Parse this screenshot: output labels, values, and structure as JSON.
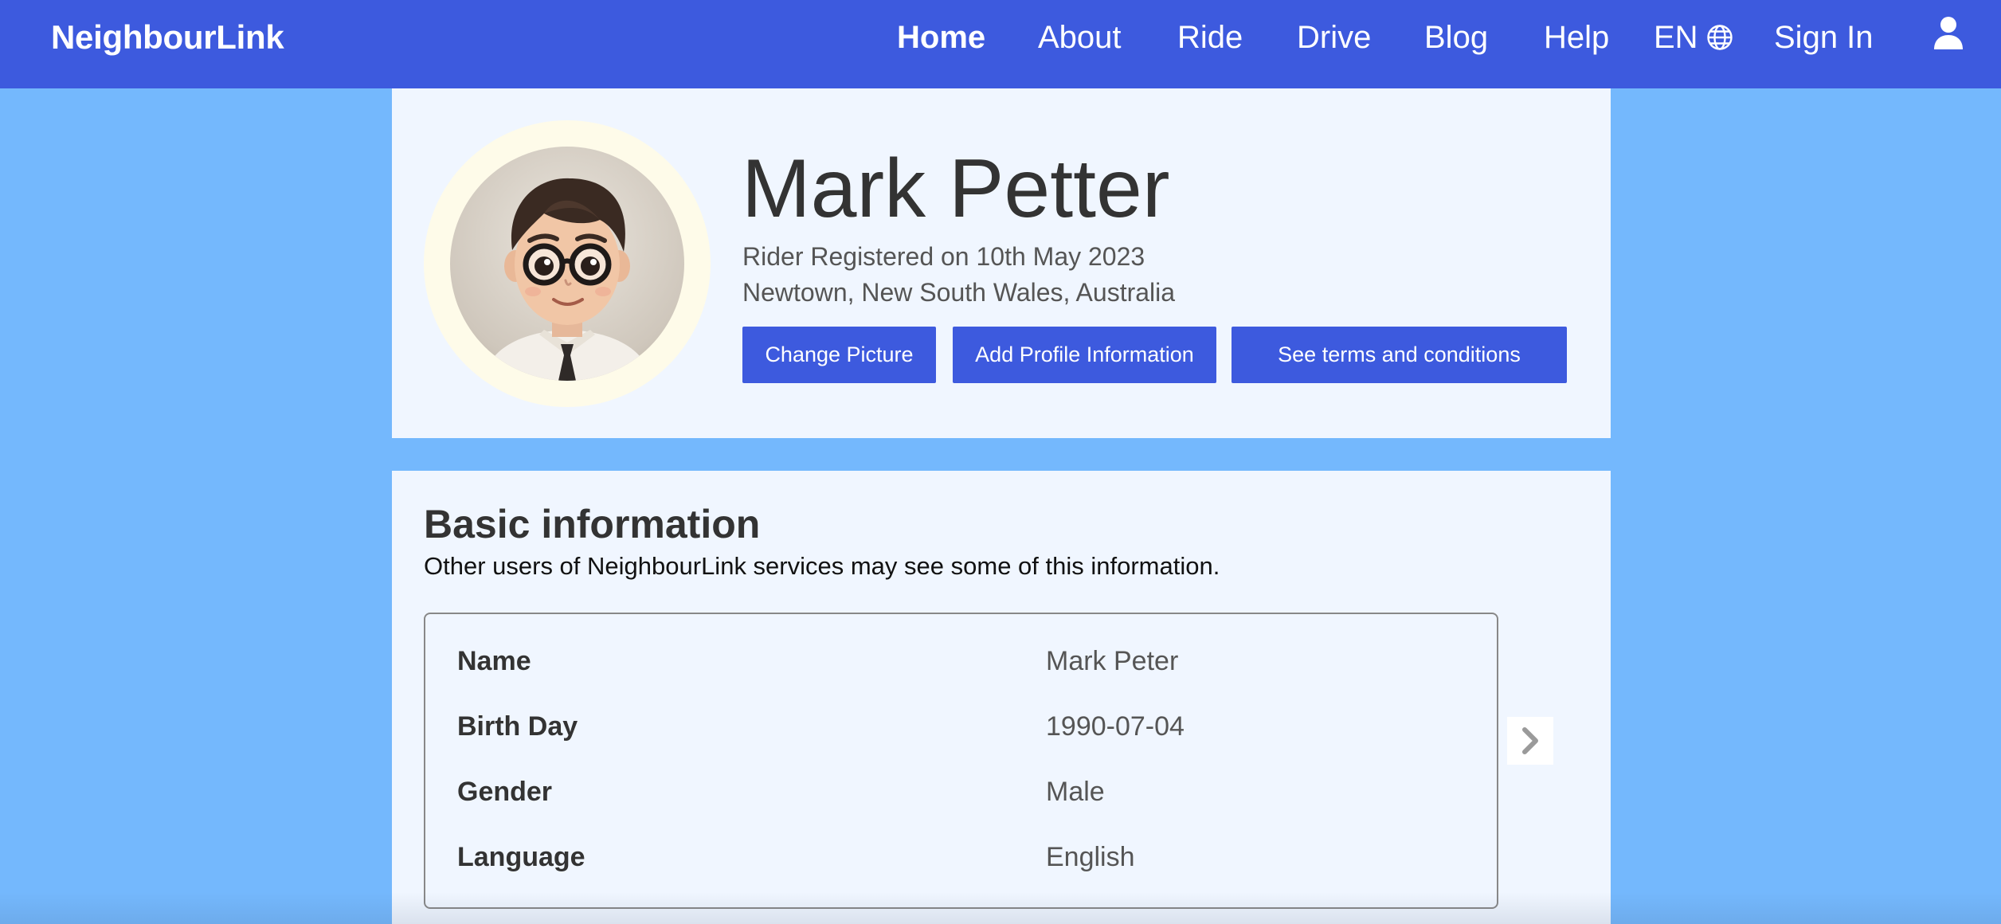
{
  "navbar": {
    "brand": "NeighbourLink",
    "items": [
      {
        "label": "Home",
        "active": true
      },
      {
        "label": "About",
        "active": false
      },
      {
        "label": "Ride",
        "active": false
      },
      {
        "label": "Drive",
        "active": false
      },
      {
        "label": "Blog",
        "active": false
      },
      {
        "label": "Help",
        "active": false
      }
    ],
    "language": "EN",
    "language_icon": "globe-icon",
    "sign_in": "Sign In",
    "account_icon": "user-icon"
  },
  "profile": {
    "name": "Mark Petter",
    "registered": "Rider Registered on 10th May 2023",
    "location": "Newtown, New South Wales, Australia",
    "avatar": "cartoon-avatar",
    "buttons": {
      "change_picture": "Change Picture",
      "add_info": "Add Profile Information",
      "terms": "See terms and conditions"
    }
  },
  "basic_info": {
    "title": "Basic information",
    "subtitle": "Other users of NeighbourLink services may see some of this information.",
    "rows": [
      {
        "label": "Name",
        "value": "Mark Peter"
      },
      {
        "label": "Birth Day",
        "value": "1990-07-04"
      },
      {
        "label": "Gender",
        "value": "Male"
      },
      {
        "label": "Language",
        "value": "English"
      }
    ],
    "next_icon": "chevron-right-icon"
  },
  "colors": {
    "primary": "#3d5ade",
    "page_background": "#74b8fd",
    "card_background": "#f0f6ff",
    "avatar_ring": "#fefbe9",
    "text_dark": "#333333",
    "text_muted": "#555555"
  }
}
